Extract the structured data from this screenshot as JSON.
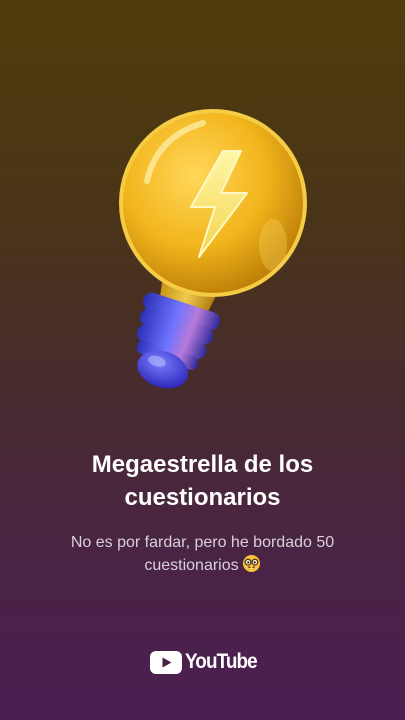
{
  "achievement": {
    "title": "Megaestrella de los cuestionarios",
    "description": "No es por fardar, pero he bordado 50 cuestionarios",
    "emoji": "nerd-face"
  },
  "brand": {
    "name": "YouTube",
    "logo_color": "#ffffff"
  },
  "colors": {
    "background_top": "#4f3c0a",
    "background_bottom": "#4b1e52",
    "bulb_gold": "#f0b41a",
    "bulb_base_blue": "#3a3fd8"
  }
}
